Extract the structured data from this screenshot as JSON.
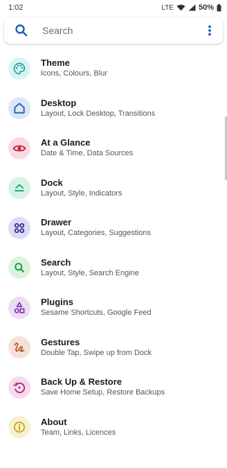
{
  "status_bar": {
    "time": "1:02",
    "network": "LTE",
    "battery": "50%"
  },
  "search": {
    "placeholder": "Search"
  },
  "items": [
    {
      "title": "Theme",
      "subtitle": "Icons, Colours, Blur",
      "icon": "palette-icon",
      "fg": "#1aa3a3",
      "bg": "#d9f3f3"
    },
    {
      "title": "Desktop",
      "subtitle": "Layout, Lock Desktop, Transitions",
      "icon": "home-icon",
      "fg": "#1f5fb4",
      "bg": "#dbe6f6"
    },
    {
      "title": "At a Glance",
      "subtitle": "Date & Time, Data Sources",
      "icon": "eye-icon",
      "fg": "#c0223a",
      "bg": "#f8dbe0"
    },
    {
      "title": "Dock",
      "subtitle": "Layout, Style, Indicators",
      "icon": "dock-icon",
      "fg": "#1aa36a",
      "bg": "#d8f3e6"
    },
    {
      "title": "Drawer",
      "subtitle": "Layout, Categories, Suggestions",
      "icon": "apps-grid-icon",
      "fg": "#2d2c8c",
      "bg": "#dedcf3"
    },
    {
      "title": "Search",
      "subtitle": "Layout, Style, Search Engine",
      "icon": "search-icon",
      "fg": "#1f9d3a",
      "bg": "#daf2de"
    },
    {
      "title": "Plugins",
      "subtitle": "Sesame Shortcuts, Google Feed",
      "icon": "shapes-icon",
      "fg": "#7a2cb0",
      "bg": "#eedcf5"
    },
    {
      "title": "Gestures",
      "subtitle": "Double Tap, Swipe up from Dock",
      "icon": "gesture-icon",
      "fg": "#b24a1e",
      "bg": "#f6e1d7"
    },
    {
      "title": "Back Up & Restore",
      "subtitle": "Save Home Setup, Restore Backups",
      "icon": "restore-icon",
      "fg": "#b3207e",
      "bg": "#f5dbec"
    },
    {
      "title": "About",
      "subtitle": "Team, Links, Licences",
      "icon": "info-icon",
      "fg": "#c9a100",
      "bg": "#f7f0d2"
    }
  ]
}
